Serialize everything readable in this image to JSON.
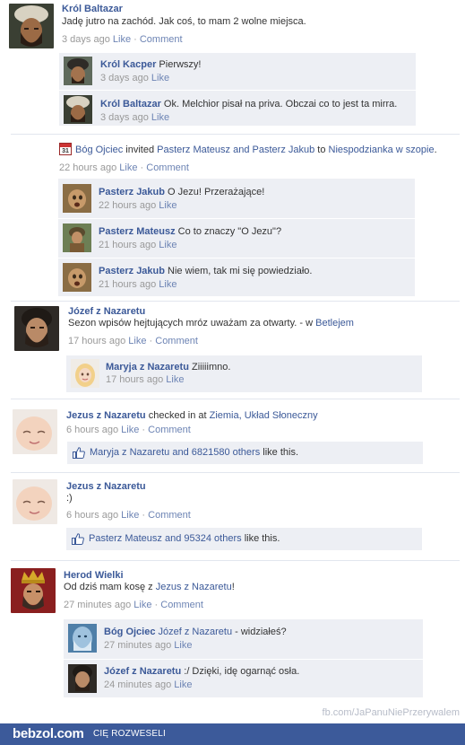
{
  "posts": [
    {
      "author": "Król Baltazar",
      "message": "Jadę jutro na zachód. Jak coś, to mam 2 wolne miejsca.",
      "time": "3 days ago",
      "like": "Like",
      "comment": "Comment",
      "comments": [
        {
          "author": "Król Kacper",
          "text": "Pierwszy!",
          "time": "3 days ago",
          "like": "Like"
        },
        {
          "author": "Król Baltazar",
          "text": "Ok. Melchior pisał na priva. Obczai co to jest ta mirra.",
          "time": "3 days ago",
          "like": "Like"
        }
      ]
    },
    {
      "calendar_icon_text": "31",
      "actor": "Bóg Ojciec",
      "verb": "invited",
      "invitee1": "Pasterz Mateusz",
      "and_word": "and",
      "invitee2": "Pasterz Jakub",
      "to_word": "to",
      "event": "Niespodzianka w szopie",
      "period": ".",
      "time": "22 hours ago",
      "like": "Like",
      "comment": "Comment",
      "comments": [
        {
          "author": "Pasterz Jakub",
          "text": "O Jezu! Przerażające!",
          "time": "22 hours ago",
          "like": "Like"
        },
        {
          "author": "Pasterz Mateusz",
          "text": "Co to znaczy \"O Jezu\"?",
          "time": "21 hours ago",
          "like": "Like"
        },
        {
          "author": "Pasterz Jakub",
          "text": "Nie wiem, tak mi się powiedziało.",
          "time": "21 hours ago",
          "like": "Like"
        }
      ]
    },
    {
      "author": "Józef z Nazaretu",
      "message": "Sezon wpisów hejtujących mróz uważam za otwarty. - w",
      "place": "Betlejem",
      "time": "17 hours ago",
      "like": "Like",
      "comment": "Comment",
      "comments": [
        {
          "author": "Maryja z Nazaretu",
          "text": "Ziiiiimno.",
          "time": "17 hours ago",
          "like": "Like"
        }
      ]
    },
    {
      "author": "Jezus z Nazaretu",
      "action": "checked in at",
      "place": "Ziemia, Układ Słoneczny",
      "time": "6 hours ago",
      "like": "Like",
      "comment": "Comment",
      "likes_person": "Maryja z Nazaretu",
      "likes_and": "and",
      "likes_others": "6821580 others",
      "likes_suffix": "like this."
    },
    {
      "author": "Jezus z Nazaretu",
      "message": ":)",
      "time": "6 hours ago",
      "like": "Like",
      "comment": "Comment",
      "likes_person": "Pasterz Mateusz",
      "likes_and": "and",
      "likes_others": "95324 others",
      "likes_suffix": "like this."
    },
    {
      "author": "Herod Wielki",
      "message": "Od dziś mam kosę z",
      "mention": "Jezus z Nazaretu",
      "message_end": "!",
      "time": "27 minutes ago",
      "like": "Like",
      "comment": "Comment",
      "comments": [
        {
          "author": "Bóg Ojciec",
          "mention": "Józef z Nazaretu",
          "text": "- widziałeś?",
          "time": "27 minutes ago",
          "like": "Like"
        },
        {
          "author": "Józef z Nazaretu",
          "text": ":/ Dzięki, idę ogarnąć osła.",
          "time": "24 minutes ago",
          "like": "Like"
        }
      ]
    }
  ],
  "watermark": "fb.com/JaPanuNiePrzerywalem",
  "footer": {
    "logo": "bebzol.com",
    "tagline": "CIĘ ROZWESELI"
  },
  "colors": {
    "link": "#3b5998",
    "meta": "#999999",
    "comment_bg": "#edeff4",
    "footer_bg": "#3c5a9a"
  }
}
